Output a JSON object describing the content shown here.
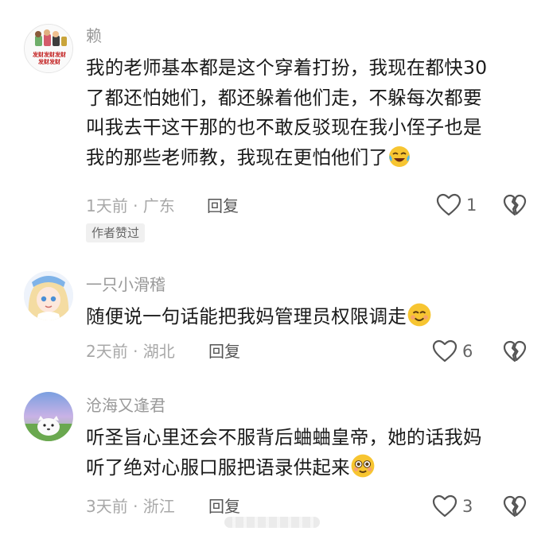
{
  "comments": [
    {
      "username": "赖",
      "avatar_text_line1": "发财发财发财",
      "avatar_text_line2": "发财发财",
      "lines": [
        "我的老师基本都是这个穿着打扮，我现在都快30",
        "了都还怕她们，都还躲着他们走，不躲每次都要",
        "叫我去干这干那的也不敢反驳现在我小侄子也是",
        "我的那些老师教，我现在更怕他们了"
      ],
      "emoji": "crying-laughing-emoji",
      "meta": "1天前 · 广东",
      "reply_label": "回复",
      "likes": "1",
      "badge": "作者赞过"
    },
    {
      "username": "一只小滑稽",
      "lines": [
        "随便说一句话能把我妈管理员权限调走"
      ],
      "emoji": "smiling-face-emoji",
      "meta": "2天前 · 湖北",
      "reply_label": "回复",
      "likes": "6"
    },
    {
      "username": "沧海又逢君",
      "lines": [
        "听圣旨心里还会不服背后蛐蛐皇帝，她的话我妈",
        "听了绝对心服口服把语录供起来"
      ],
      "emoji": "flushed-face-emoji",
      "meta": "3天前 · 浙江",
      "reply_label": "回复",
      "likes": "3"
    }
  ],
  "colors": {
    "username": "#999999",
    "content": "#1a1a1a",
    "meta": "#a8a8a8",
    "icon": "#555555"
  }
}
